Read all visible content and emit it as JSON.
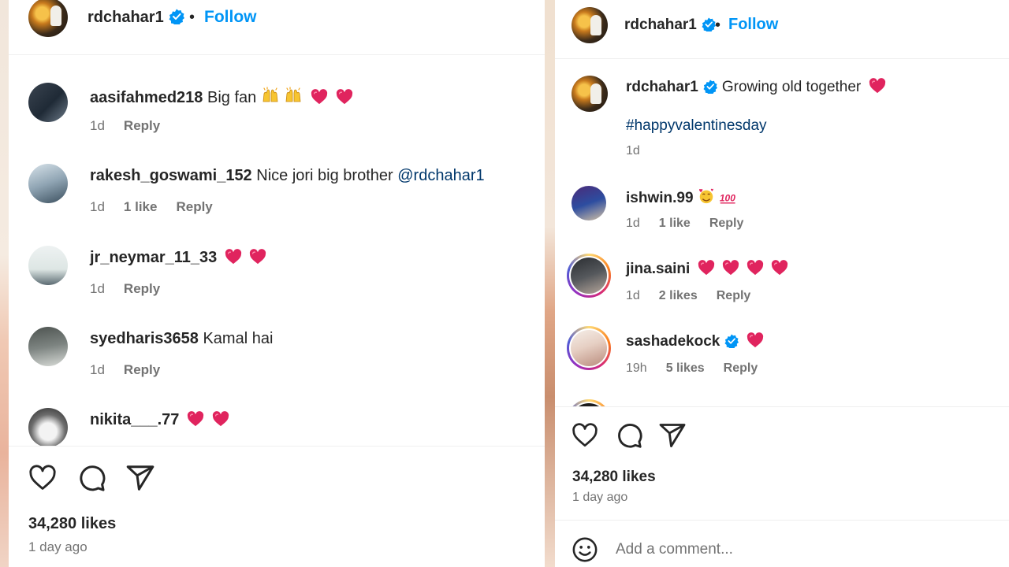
{
  "left": {
    "owner": "rdchahar1",
    "follow_label": "Follow",
    "separator": "•",
    "comments": [
      {
        "username": "aasifahmed218",
        "text": "Big fan",
        "emojis": [
          "raised-hands",
          "raised-hands",
          "red-heart",
          "red-heart"
        ],
        "time": "1d",
        "likes": "",
        "reply": "Reply"
      },
      {
        "username": "rakesh_goswami_152",
        "text": "Nice jori big brother",
        "mention": "@rdchahar1",
        "time": "1d",
        "likes": "1 like",
        "reply": "Reply"
      },
      {
        "username": "jr_neymar_11_33",
        "text": "",
        "emojis": [
          "red-heart",
          "red-heart"
        ],
        "time": "1d",
        "likes": "",
        "reply": "Reply"
      },
      {
        "username": "syedharis3658",
        "text": "Kamal hai",
        "time": "1d",
        "likes": "",
        "reply": "Reply"
      },
      {
        "username": "nikita___.77",
        "text": "",
        "emojis": [
          "red-heart",
          "red-heart"
        ]
      }
    ],
    "likes": "34,280 likes",
    "time_ago": "1 day ago"
  },
  "right": {
    "owner": "rdchahar1",
    "follow_label": "Follow",
    "separator": "•",
    "caption": {
      "username": "rdchahar1",
      "text": "Growing old together",
      "hashtag": "#happyvalentinesday",
      "time": "1d"
    },
    "comments": [
      {
        "username": "ishwin.99",
        "emojis": [
          "smiling-face-with-hearts",
          "hundred-points"
        ],
        "time": "1d",
        "likes": "1 like",
        "reply": "Reply"
      },
      {
        "username": "jina.saini",
        "emojis": [
          "red-heart",
          "red-heart",
          "red-heart",
          "red-heart"
        ],
        "time": "1d",
        "likes": "2 likes",
        "reply": "Reply"
      },
      {
        "username": "sashadekock",
        "verified": true,
        "emojis": [
          "red-heart"
        ],
        "time": "19h",
        "likes": "5 likes",
        "reply": "Reply"
      }
    ],
    "likes": "34,280 likes",
    "time_ago": "1 day ago",
    "comment_placeholder": "Add a comment..."
  },
  "colors": {
    "link": "#00376b",
    "follow": "#0095f6",
    "verified": "#0095f6",
    "heart": "#e0245e",
    "muted": "#737373"
  }
}
